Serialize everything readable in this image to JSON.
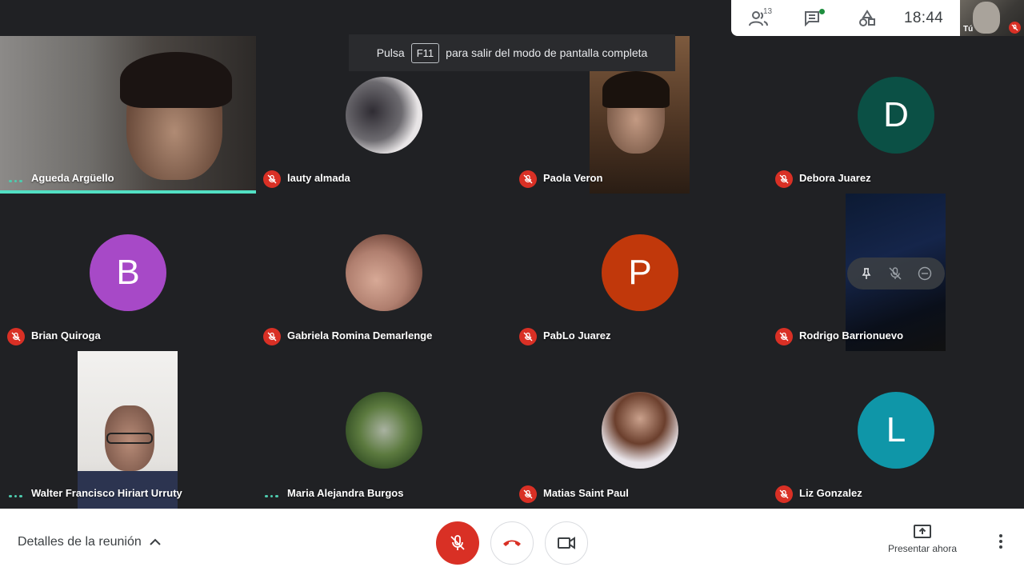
{
  "topbar": {
    "participants_count": "13",
    "clock": "18:44",
    "self_label": "Tú"
  },
  "toast": {
    "prefix": "Pulsa",
    "key": "F11",
    "suffix": "para salir del modo de pantalla completa"
  },
  "tiles": [
    {
      "name": "Agueda Argüello",
      "state": "speaking",
      "kind": "video"
    },
    {
      "name": "lauty almada",
      "state": "muted",
      "kind": "photo"
    },
    {
      "name": "Paola Veron",
      "state": "muted",
      "kind": "video"
    },
    {
      "name": "Debora Juarez",
      "state": "muted",
      "kind": "initial",
      "initial": "D",
      "color": "#0b5045"
    },
    {
      "name": "Brian Quiroga",
      "state": "muted",
      "kind": "initial",
      "initial": "B",
      "color": "#a749c7"
    },
    {
      "name": "Gabriela Romina Demarlenge",
      "state": "muted",
      "kind": "photo"
    },
    {
      "name": "PabLo Juarez",
      "state": "muted",
      "kind": "initial",
      "initial": "P",
      "color": "#c1380b"
    },
    {
      "name": "Rodrigo Barrionuevo",
      "state": "muted",
      "kind": "video"
    },
    {
      "name": "Walter Francisco Hiriart Urruty",
      "state": "connected",
      "kind": "video"
    },
    {
      "name": "Maria Alejandra Burgos",
      "state": "connected",
      "kind": "photo"
    },
    {
      "name": "Matias Saint Paul",
      "state": "muted",
      "kind": "photo"
    },
    {
      "name": "Liz Gonzalez",
      "state": "muted",
      "kind": "initial",
      "initial": "L",
      "color": "#0f96a8"
    }
  ],
  "bottombar": {
    "details_label": "Detalles de la reunión",
    "present_label": "Presentar ahora"
  },
  "colors": {
    "background": "#202124",
    "mute_red": "#d93025",
    "speaking_accent": "#52e0c4"
  }
}
